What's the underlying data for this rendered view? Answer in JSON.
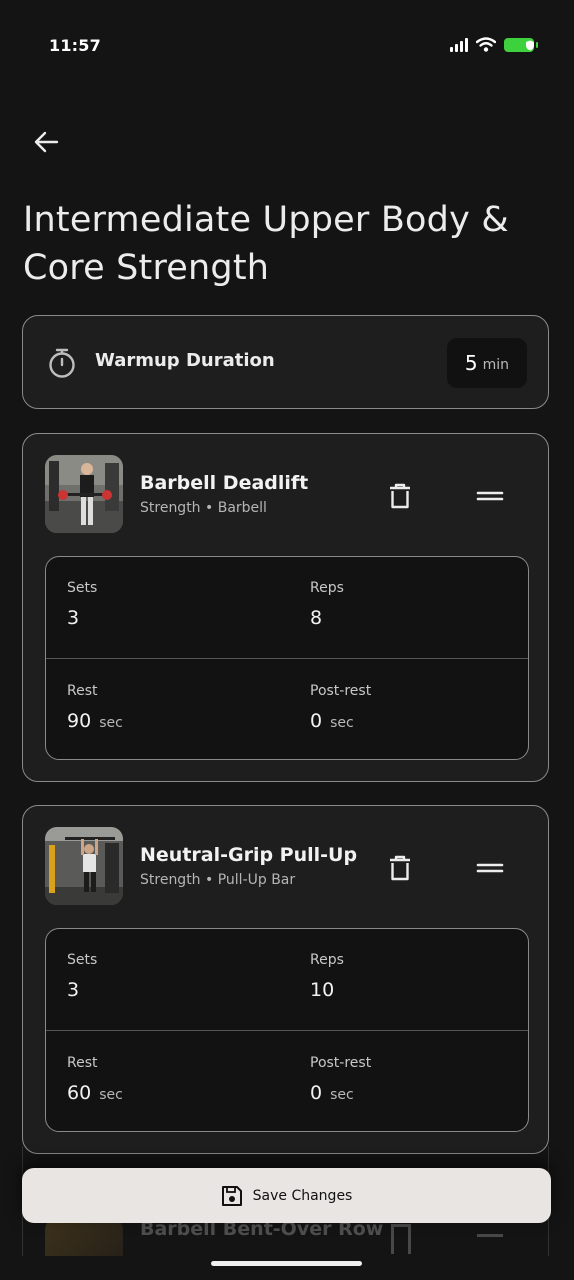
{
  "status_bar": {
    "time": "11:57"
  },
  "page": {
    "title": "Intermediate Upper Body & Core Strength"
  },
  "warmup": {
    "label": "Warmup Duration",
    "value": "5",
    "unit": "min"
  },
  "exercises": [
    {
      "name": "Barbell Deadlift",
      "subtitle": "Strength • Barbell",
      "sets_label": "Sets",
      "sets": "3",
      "reps_label": "Reps",
      "reps": "8",
      "rest_label": "Rest",
      "rest": "90",
      "rest_unit": "sec",
      "post_rest_label": "Post-rest",
      "post_rest": "0",
      "post_rest_unit": "sec"
    },
    {
      "name": "Neutral-Grip Pull-Up",
      "subtitle": "Strength • Pull-Up Bar",
      "sets_label": "Sets",
      "sets": "3",
      "reps_label": "Reps",
      "reps": "10",
      "rest_label": "Rest",
      "rest": "60",
      "rest_unit": "sec",
      "post_rest_label": "Post-rest",
      "post_rest": "0",
      "post_rest_unit": "sec"
    },
    {
      "name": "Barbell Bent-Over Row"
    }
  ],
  "footer": {
    "save_label": "Save Changes"
  },
  "icons": {
    "back": "arrow-left-icon",
    "timer": "stopwatch-icon",
    "delete": "trash-icon",
    "reorder": "drag-handle-icon",
    "save": "floppy-disk-icon"
  },
  "colors": {
    "background": "#141414",
    "card": "#1E1E1E",
    "battery": "#3DD13E",
    "save_button": "#E8E5E3"
  }
}
